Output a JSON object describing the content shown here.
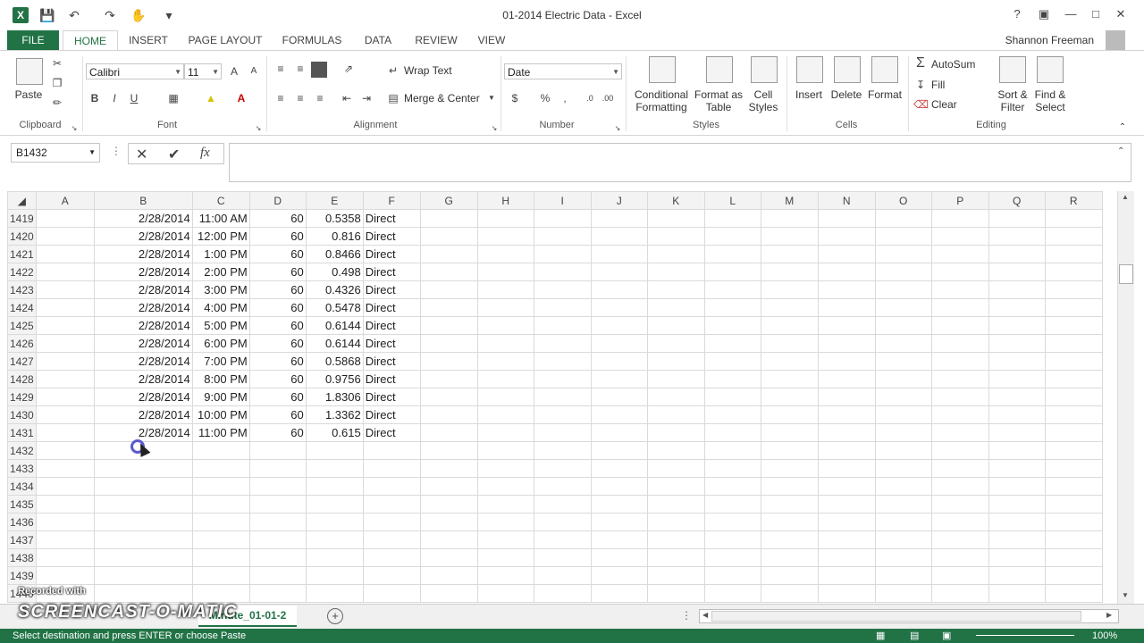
{
  "window": {
    "title": "01-2014 Electric Data - Excel",
    "app_icon": "X",
    "help": "?",
    "user_name": "Shannon Freeman"
  },
  "tabs": [
    "FILE",
    "HOME",
    "INSERT",
    "PAGE LAYOUT",
    "FORMULAS",
    "DATA",
    "REVIEW",
    "VIEW"
  ],
  "ribbon": {
    "clipboard": {
      "paste": "Paste",
      "label": "Clipboard"
    },
    "font": {
      "name": "Calibri",
      "size": "11",
      "label": "Font",
      "bold": "B",
      "italic": "I",
      "underline": "U",
      "grow": "A",
      "shrink": "A"
    },
    "alignment": {
      "wrap_text": "Wrap Text",
      "merge_center": "Merge & Center",
      "label": "Alignment"
    },
    "number": {
      "format": "Date",
      "currency": "$",
      "percent": "%",
      "comma": ",",
      "label": "Number"
    },
    "styles": {
      "conditional": "Conditional",
      "conditional2": "Formatting",
      "format_table": "Format as",
      "format_table2": "Table",
      "cell_styles": "Cell",
      "cell_styles2": "Styles",
      "label": "Styles"
    },
    "cells": {
      "insert": "Insert",
      "delete": "Delete",
      "format": "Format",
      "label": "Cells"
    },
    "editing": {
      "autosum": "AutoSum",
      "fill": "Fill",
      "clear": "Clear",
      "sort": "Sort &",
      "sort2": "Filter",
      "find": "Find &",
      "find2": "Select",
      "label": "Editing"
    }
  },
  "formula_bar": {
    "name_box": "B1432",
    "fx": "fx",
    "value": ""
  },
  "columns": [
    "A",
    "B",
    "C",
    "D",
    "E",
    "F",
    "G",
    "H",
    "I",
    "J",
    "K",
    "L",
    "M",
    "N",
    "O",
    "P",
    "Q",
    "R"
  ],
  "rows": [
    {
      "n": "1419",
      "b": "2/28/2014",
      "c": "11:00 AM",
      "d": "60",
      "e": "0.5358",
      "f": "Direct"
    },
    {
      "n": "1420",
      "b": "2/28/2014",
      "c": "12:00 PM",
      "d": "60",
      "e": "0.816",
      "f": "Direct"
    },
    {
      "n": "1421",
      "b": "2/28/2014",
      "c": "1:00 PM",
      "d": "60",
      "e": "0.8466",
      "f": "Direct"
    },
    {
      "n": "1422",
      "b": "2/28/2014",
      "c": "2:00 PM",
      "d": "60",
      "e": "0.498",
      "f": "Direct"
    },
    {
      "n": "1423",
      "b": "2/28/2014",
      "c": "3:00 PM",
      "d": "60",
      "e": "0.4326",
      "f": "Direct"
    },
    {
      "n": "1424",
      "b": "2/28/2014",
      "c": "4:00 PM",
      "d": "60",
      "e": "0.5478",
      "f": "Direct"
    },
    {
      "n": "1425",
      "b": "2/28/2014",
      "c": "5:00 PM",
      "d": "60",
      "e": "0.6144",
      "f": "Direct"
    },
    {
      "n": "1426",
      "b": "2/28/2014",
      "c": "6:00 PM",
      "d": "60",
      "e": "0.6144",
      "f": "Direct"
    },
    {
      "n": "1427",
      "b": "2/28/2014",
      "c": "7:00 PM",
      "d": "60",
      "e": "0.5868",
      "f": "Direct"
    },
    {
      "n": "1428",
      "b": "2/28/2014",
      "c": "8:00 PM",
      "d": "60",
      "e": "0.9756",
      "f": "Direct"
    },
    {
      "n": "1429",
      "b": "2/28/2014",
      "c": "9:00 PM",
      "d": "60",
      "e": "1.8306",
      "f": "Direct"
    },
    {
      "n": "1430",
      "b": "2/28/2014",
      "c": "10:00 PM",
      "d": "60",
      "e": "1.3362",
      "f": "Direct"
    },
    {
      "n": "1431",
      "b": "2/28/2014",
      "c": "11:00 PM",
      "d": "60",
      "e": "0.615",
      "f": "Direct"
    },
    {
      "n": "1432",
      "b": "",
      "c": "",
      "d": "",
      "e": "",
      "f": ""
    },
    {
      "n": "1433",
      "b": "",
      "c": "",
      "d": "",
      "e": "",
      "f": ""
    },
    {
      "n": "1434",
      "b": "",
      "c": "",
      "d": "",
      "e": "",
      "f": ""
    },
    {
      "n": "1435",
      "b": "",
      "c": "",
      "d": "",
      "e": "",
      "f": ""
    },
    {
      "n": "1436",
      "b": "",
      "c": "",
      "d": "",
      "e": "",
      "f": ""
    },
    {
      "n": "1437",
      "b": "",
      "c": "",
      "d": "",
      "e": "",
      "f": ""
    },
    {
      "n": "1438",
      "b": "",
      "c": "",
      "d": "",
      "e": "",
      "f": ""
    },
    {
      "n": "1439",
      "b": "",
      "c": "",
      "d": "",
      "e": "",
      "f": ""
    },
    {
      "n": "1440",
      "b": "",
      "c": "",
      "d": "",
      "e": "",
      "f": ""
    }
  ],
  "sheet_tab": "Minute_01-01-2",
  "status": "Select destination and press ENTER or choose Paste",
  "zoom": "100%",
  "watermark": {
    "line1": "Recorded with",
    "line2": "SCREENCAST-O-MATIC"
  },
  "colors": {
    "accent": "#217346"
  }
}
